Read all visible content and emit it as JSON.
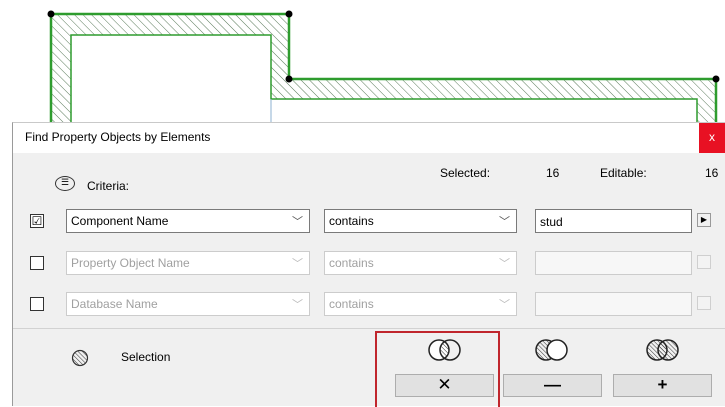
{
  "dialog": {
    "title": "Find Property Objects by Elements",
    "close_label": "x",
    "selected_label": "Selected:",
    "selected_count": "16",
    "editable_label": "Editable:",
    "editable_count": "16",
    "criteria_label": "Criteria:"
  },
  "rows": [
    {
      "checked_mark": "☑",
      "field": "Component Name",
      "operator": "contains",
      "value": "stud",
      "enabled": true
    },
    {
      "checked_mark": "",
      "field": "Property Object Name",
      "operator": "contains",
      "value": "",
      "enabled": false
    },
    {
      "checked_mark": "",
      "field": "Database Name",
      "operator": "contains",
      "value": "",
      "enabled": false
    }
  ],
  "footer": {
    "selection_label": "Selection",
    "buttons": [
      "✕",
      "—",
      "+"
    ]
  },
  "colors": {
    "wall_outline": "#2e9c2e",
    "hatch": "#4a7a4a",
    "highlight": "#c0262d",
    "close_bg": "#e81123"
  },
  "icons": [
    "criteria-icon",
    "selection-icon",
    "intersect-icon",
    "subtract-icon",
    "union-icon",
    "arrow-right-icon",
    "chevron-down-icon"
  ]
}
